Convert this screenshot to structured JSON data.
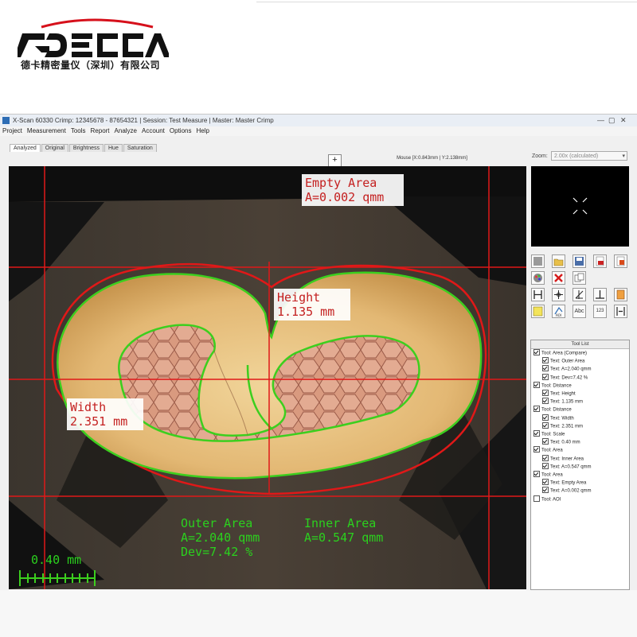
{
  "company": {
    "logo_text": "DECCA",
    "name_cn": "德卡精密量仪（深圳）有限公司",
    "brand_color": "#d6101b",
    "logo_color": "#111111"
  },
  "window": {
    "title": "X-Scan 60330 Crimp: 12345678 - 87654321 | Session: Test Measure | Master: Master Crimp",
    "controls": [
      "—",
      "▢",
      "✕"
    ]
  },
  "menu": [
    "Project",
    "Measurement",
    "Tools",
    "Report",
    "Analyze",
    "Account",
    "Options",
    "Help"
  ],
  "tabs": [
    {
      "label": "Analyzed",
      "active": true
    },
    {
      "label": "Original",
      "active": false
    },
    {
      "label": "Brightness",
      "active": false
    },
    {
      "label": "Hue",
      "active": false
    },
    {
      "label": "Saturation",
      "active": false
    }
  ],
  "mouse_readout": "Mouse [X:0.843mm | Y:2.138mm]",
  "zoom": {
    "label": "Zoom:",
    "value": "2.00x (calculated)"
  },
  "annotations": {
    "empty_area": {
      "line1": "Empty Area",
      "line2": "A=0.002 qmm"
    },
    "height": {
      "line1": "Height",
      "line2": "1.135 mm"
    },
    "width": {
      "line1": "Width",
      "line2": "2.351 mm"
    },
    "outer_area": {
      "line1": "Outer Area",
      "line2": "A=2.040 qmm",
      "line3": "Dev=7.42 %"
    },
    "inner_area": {
      "line1": "Inner Area",
      "line2": "A=0.547 qmm"
    },
    "scale": {
      "label": "0.40 mm"
    }
  },
  "colors": {
    "measure_red": "#e01818",
    "contour_green": "#3ccf1e",
    "label_red_text": "#c42020",
    "label_green_text": "#2bd11e"
  },
  "toolbar_buttons": [
    "square-icon",
    "folder-icon",
    "save-icon",
    "pdf-icon",
    "report-icon",
    "palette-icon",
    "delete-icon",
    "copy-icon",
    "distance-icon",
    "pointer-icon",
    "angle-icon",
    "perpendicular-icon",
    "export-icon",
    "calculate-icon",
    "aoi-icon",
    "text-abc-icon",
    "number-123-icon",
    "width-icon"
  ],
  "toolbar_text": {
    "aoi": "AOI",
    "abc": "Abc",
    "num": "123"
  },
  "tool_list": {
    "title": "Tool List",
    "items": [
      {
        "text": "Tool: Area (Compare)",
        "level": 0,
        "checked": true
      },
      {
        "text": "Text: Outer Area",
        "level": 1,
        "checked": true
      },
      {
        "text": "Text: A=2.040 qmm",
        "level": 1,
        "checked": true
      },
      {
        "text": "Text: Dev=7.42 %",
        "level": 1,
        "checked": true
      },
      {
        "text": "Tool: Distance",
        "level": 0,
        "checked": true
      },
      {
        "text": "Text: Height",
        "level": 1,
        "checked": true
      },
      {
        "text": "Text: 1.135 mm",
        "level": 1,
        "checked": true
      },
      {
        "text": "Tool: Distance",
        "level": 0,
        "checked": true
      },
      {
        "text": "Text: Width",
        "level": 1,
        "checked": true
      },
      {
        "text": "Text: 2.351 mm",
        "level": 1,
        "checked": true
      },
      {
        "text": "Tool: Scale",
        "level": 0,
        "checked": true
      },
      {
        "text": "Text: 0.40 mm",
        "level": 1,
        "checked": true
      },
      {
        "text": "Tool: Area",
        "level": 0,
        "checked": true
      },
      {
        "text": "Text: Inner Area",
        "level": 1,
        "checked": true
      },
      {
        "text": "Text: A=0.547 qmm",
        "level": 1,
        "checked": true
      },
      {
        "text": "Tool: Area",
        "level": 0,
        "checked": true
      },
      {
        "text": "Text: Empty Area",
        "level": 1,
        "checked": true
      },
      {
        "text": "Text: A=0.002 qmm",
        "level": 1,
        "checked": true
      },
      {
        "text": "Tool: AOI",
        "level": 0,
        "checked": false
      }
    ]
  }
}
